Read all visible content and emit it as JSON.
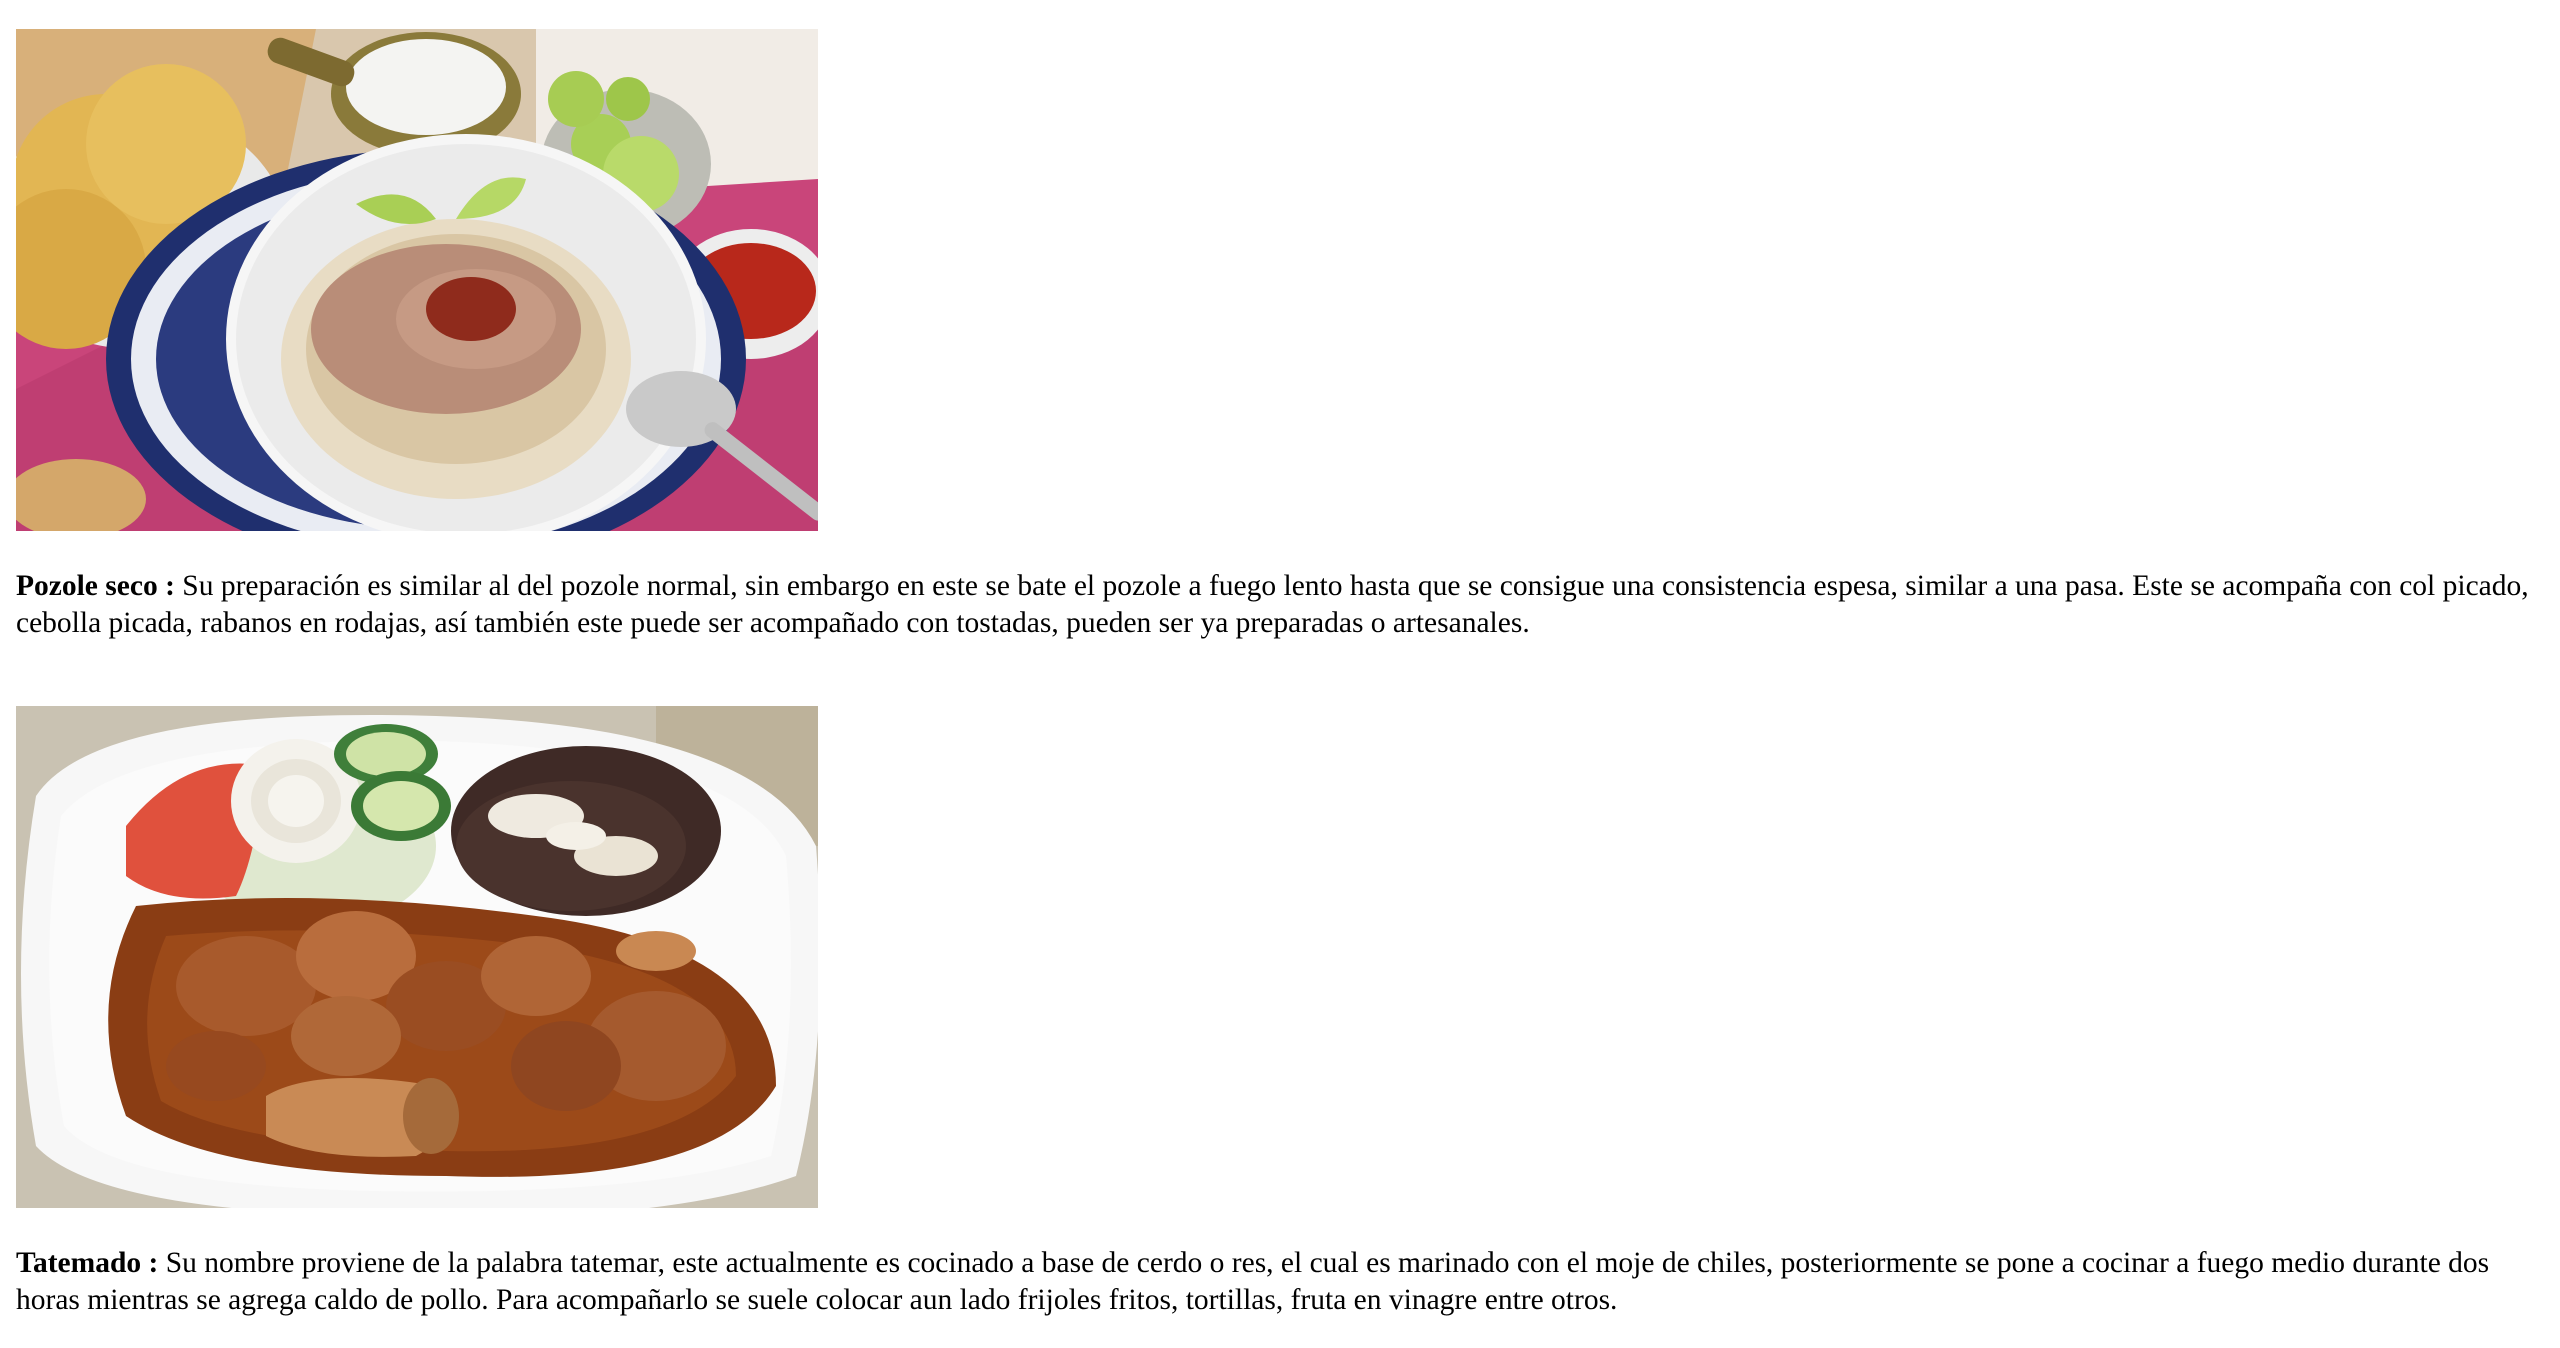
{
  "dishes": [
    {
      "image_alt": "pozole-seco",
      "title": "Pozole seco :",
      "text": " Su preparación es similar al del pozole normal, sin embargo en este se bate el pozole a fuego lento hasta que se consigue una consistencia espesa, similar a una pasa. Este se acompaña con col picado, cebolla picada, rabanos en rodajas, así también este puede ser acompañado con tostadas, pueden ser ya preparadas o artesanales."
    },
    {
      "image_alt": "tatemado",
      "title": "Tatemado :",
      "text": " Su nombre proviene de la palabra tatemar, este actualmente es cocinado a base de cerdo o res, el cual es marinado con el moje de chiles, posteriormente se pone a cocinar a fuego medio durante dos horas mientras se agrega caldo de pollo. Para acompañarlo se suele colocar aun lado frijoles fritos, tortillas, fruta en vinagre entre otros."
    }
  ]
}
